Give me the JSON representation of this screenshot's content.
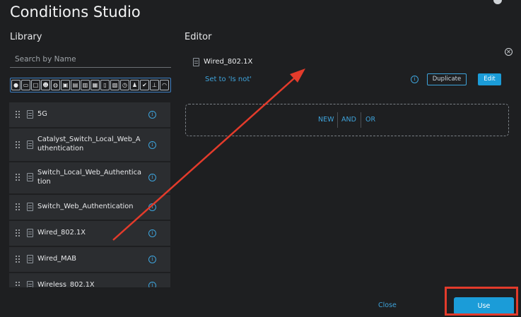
{
  "page": {
    "title": "Conditions Studio"
  },
  "library": {
    "heading": "Library",
    "search_placeholder": "Search by Name",
    "filter_icons": [
      "location-pin-icon",
      "card-icon",
      "square-icon",
      "group-icon",
      "globe-icon",
      "monitor-icon",
      "desktop-icon",
      "router-icon",
      "doc-icon",
      "phone-icon",
      "document-icon",
      "clock-icon",
      "user-icon",
      "check-icon",
      "tree-icon",
      "wifi-icon"
    ],
    "items": [
      {
        "label": "5G"
      },
      {
        "label": "Catalyst_Switch_Local_Web_Authentication"
      },
      {
        "label": "Switch_Local_Web_Authentication"
      },
      {
        "label": "Switch_Web_Authentication"
      },
      {
        "label": "Wired_802.1X"
      },
      {
        "label": "Wired_MAB"
      },
      {
        "label": "Wireless_802.1X"
      }
    ]
  },
  "editor": {
    "heading": "Editor",
    "condition_name": "Wired_802.1X",
    "set_to": "Set to 'Is not'",
    "duplicate_label": "Duplicate",
    "edit_label": "Edit",
    "operators": [
      "NEW",
      "AND",
      "OR"
    ]
  },
  "footer": {
    "close_label": "Close",
    "use_label": "Use"
  },
  "colors": {
    "accent": "#1b9cd8",
    "annotation_red": "#e33b2b",
    "background": "#1e1f21",
    "row_bg": "#2b2d30"
  }
}
